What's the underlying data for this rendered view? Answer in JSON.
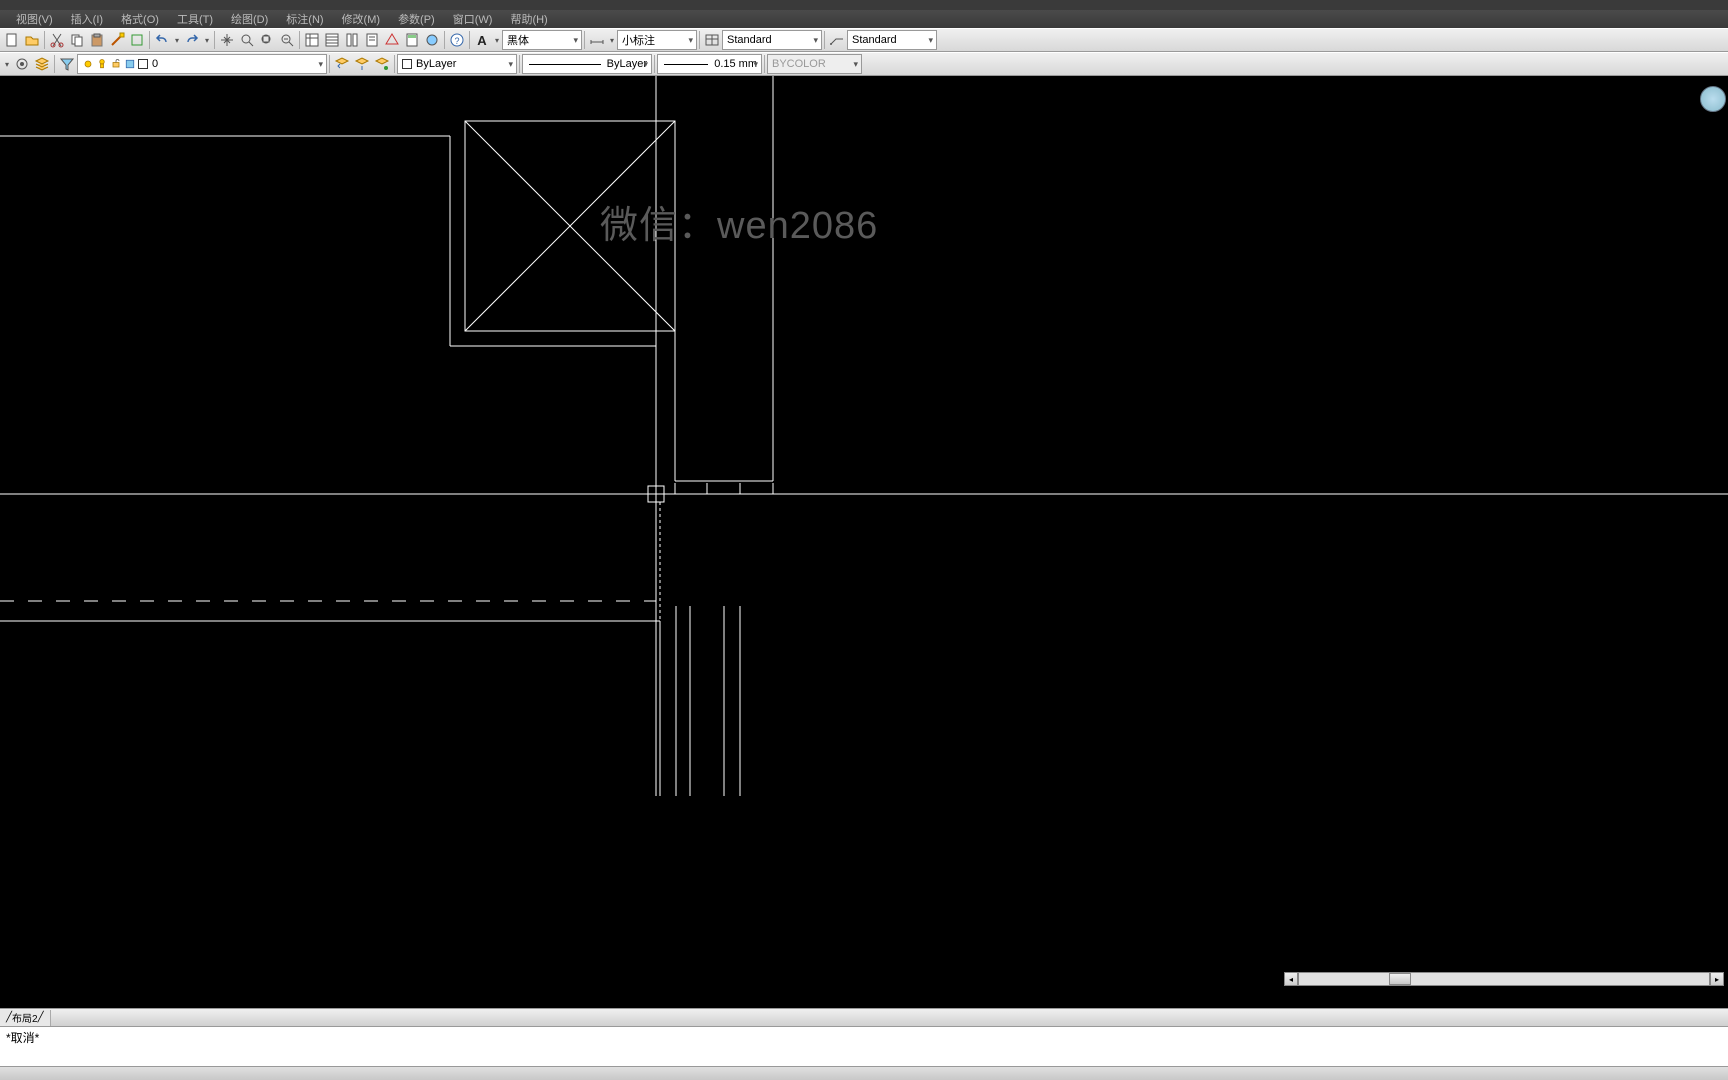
{
  "menus": {
    "view": "视图(V)",
    "insert": "插入(I)",
    "format": "格式(O)",
    "tools": "工具(T)",
    "draw": "绘图(D)",
    "dimension": "标注(N)",
    "modify": "修改(M)",
    "parametric": "参数(P)",
    "window": "窗口(W)",
    "help": "帮助(H)"
  },
  "styles": {
    "textstyle": "黑体",
    "dimstyle": "小标注",
    "tablestyle": "Standard",
    "mlstyle": "Standard"
  },
  "layer": {
    "current": "0",
    "color": "ByLayer",
    "linetype": "ByLayer",
    "lineweight": "0.15 mm",
    "plotstyle": "BYCOLOR"
  },
  "tabs": {
    "layout": "布局2"
  },
  "watermark": {
    "text": "微信：wen2086"
  },
  "command": {
    "cancel": "*取消*"
  }
}
